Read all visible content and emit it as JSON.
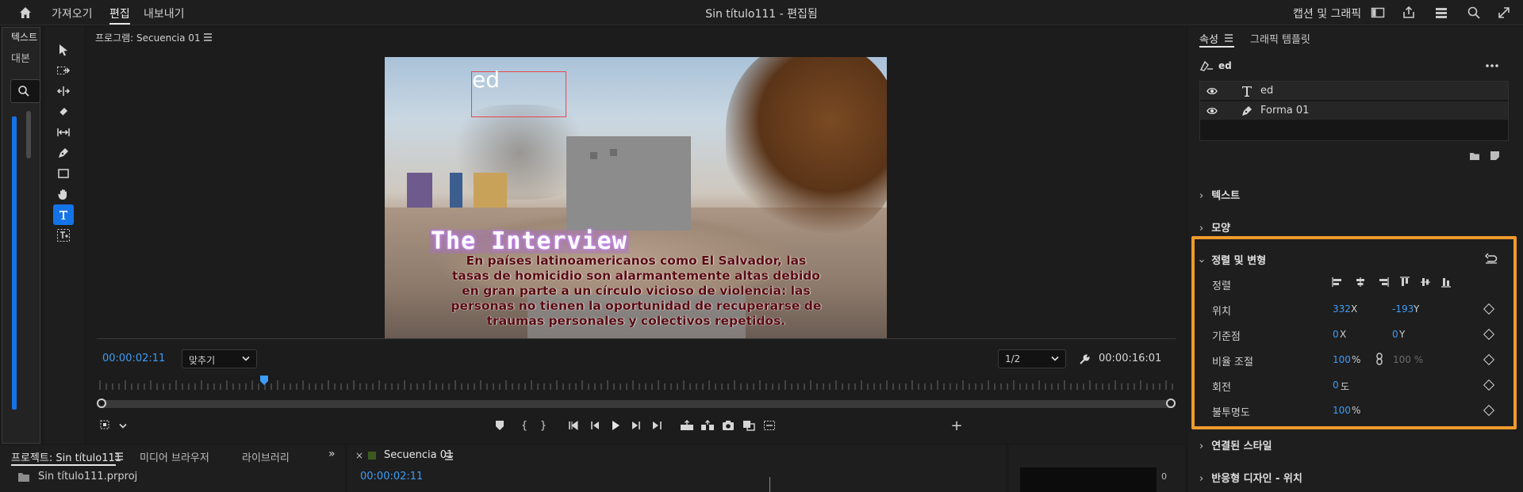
{
  "top_nav": {
    "home_icon": "home-icon",
    "items": [
      "가져오기",
      "편집",
      "내보내기"
    ],
    "active_index": 1,
    "document_title": "Sin título111 - 편집됨",
    "workspace_label": "캡션 및 그래픽"
  },
  "left_panel": {
    "tabs": [
      "텍스트",
      "대본"
    ]
  },
  "program_monitor": {
    "title": "프로그램: Secuencia 01",
    "overlay_ed": "ed",
    "overlay_title": "The Interview",
    "caption": "En países latinoamericanos como El Salvador, las tasas de homicidio son alarmantemente altas debido en gran parte a un círculo vicioso de violencia: las personas no tienen la oportunidad de recuperarse de traumas personales y colectivos repetidos.",
    "timecode_current": "00:00:02:11",
    "fit_option": "맞추기",
    "resolution_option": "1/2",
    "timecode_duration": "00:00:16:01",
    "playhead_fraction": 0.155
  },
  "bottom_left": {
    "tabs": [
      "프로젝트: Sin título111",
      "미디어 브라우저",
      "라이브러리"
    ],
    "project_file": "Sin título111.prproj"
  },
  "bottom_mid": {
    "close": "×",
    "sequence_tab": "Secuencia 01",
    "timecode": "00:00:02:11"
  },
  "bottom_right": {
    "meter_value": "0"
  },
  "properties": {
    "tabs": [
      "속성",
      "그래픽 템플릿"
    ],
    "selected_name": "ed",
    "layers": [
      {
        "name": "ed",
        "icon": "text-layer-icon"
      },
      {
        "name": "Forma 01",
        "icon": "pen-layer-icon"
      }
    ],
    "sections": {
      "text": "텍스트",
      "shape": "모양",
      "align_transform": "정렬 및 변형",
      "linked_styles": "연결된 스타일",
      "responsive": "반응형 디자인 - 위치"
    },
    "transform": {
      "align_label": "정렬",
      "position_label": "위치",
      "position_x": "332",
      "position_y": "-193",
      "anchor_label": "기준점",
      "anchor_x": "0",
      "anchor_y": "0",
      "scale_label": "비율 조절",
      "scale_value": "100",
      "scale_value2": "100 %",
      "rotation_label": "회전",
      "rotation_value": "0",
      "rotation_unit": "도",
      "opacity_label": "불투명도",
      "opacity_value": "100",
      "x_suffix": "X",
      "y_suffix": "Y",
      "pct_suffix": "%"
    },
    "highlight_color": "#ef9a2d"
  }
}
